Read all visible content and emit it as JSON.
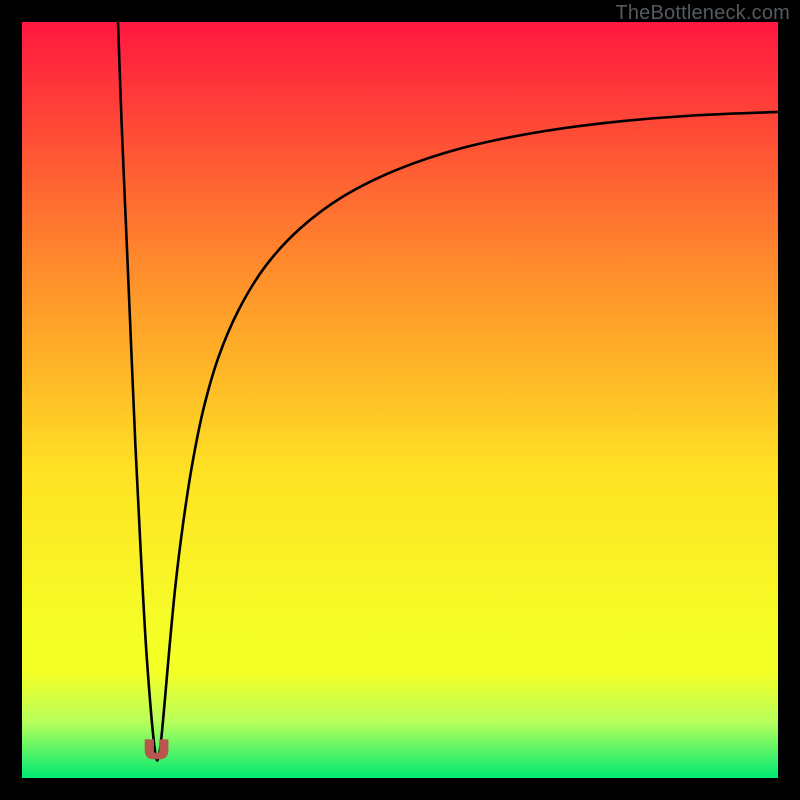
{
  "watermark": "TheBottleneck.com",
  "chart_data": {
    "type": "line",
    "title": "",
    "xlabel": "",
    "ylabel": "",
    "xlim": [
      0,
      100
    ],
    "ylim": [
      0,
      100
    ],
    "grid": false,
    "legend": false,
    "background_gradient": {
      "top": "#ff173f",
      "mid_upper": "#ff8a2c",
      "mid": "#ffe324",
      "mid_lower": "#f4ff26",
      "band": "#b8ff5a",
      "bottom": "#00e972"
    },
    "series": [
      {
        "name": "bottleneck-curve",
        "color": "#000000",
        "x": [
          12.7,
          13.2,
          13.8,
          14.4,
          15.0,
          15.7,
          16.5,
          17.6,
          18.2,
          18.8,
          19.5,
          20.3,
          21.3,
          22.5,
          24.0,
          26.0,
          28.7,
          32.2,
          36.8,
          42.6,
          49.7,
          58.1,
          67.5,
          77.6,
          88.3,
          100.0
        ],
        "y": [
          100.0,
          86.0,
          72.0,
          58.0,
          44.0,
          30.0,
          16.0,
          3.5,
          3.5,
          9.2,
          17.2,
          25.5,
          33.6,
          41.4,
          48.8,
          55.7,
          62.0,
          67.7,
          72.7,
          77.0,
          80.5,
          83.3,
          85.3,
          86.7,
          87.6,
          88.1
        ]
      },
      {
        "name": "minimum-marker",
        "color": "#b9564d",
        "type": "marker",
        "shape": "u",
        "x_center": 17.8,
        "y_center": 3.8,
        "width": 3.0,
        "height": 2.5
      }
    ]
  }
}
